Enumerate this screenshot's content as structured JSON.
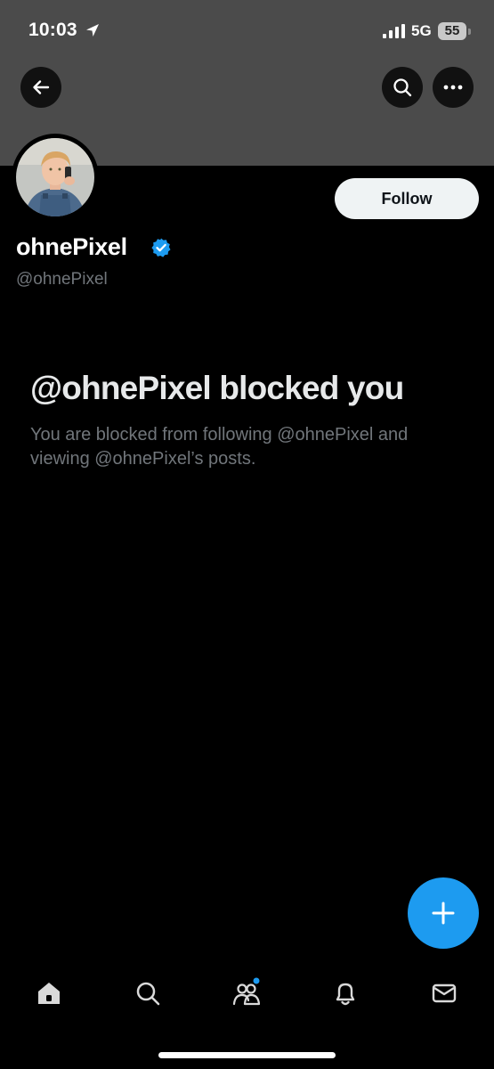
{
  "status_bar": {
    "time": "10:03",
    "network": "5G",
    "battery": "55"
  },
  "header": {
    "back_icon": "back-arrow-icon",
    "search_icon": "search-icon",
    "more_icon": "more-dots-icon"
  },
  "profile": {
    "display_name": "ohnePixel",
    "handle": "@ohnePixel",
    "verified": true,
    "follow_label": "Follow"
  },
  "blocked": {
    "title": "@ohnePixel blocked you",
    "description": "You are blocked from following @ohnePixel and viewing @ohnePixel’s posts."
  },
  "fab": {
    "icon": "plus-icon"
  },
  "tabbar": {
    "items": [
      "home-icon",
      "search-icon",
      "communities-icon",
      "notifications-icon",
      "messages-icon"
    ]
  },
  "colors": {
    "accent": "#1d9bf0",
    "banner": "#4b4b4b",
    "background": "#000000",
    "muted_text": "#71767b"
  }
}
